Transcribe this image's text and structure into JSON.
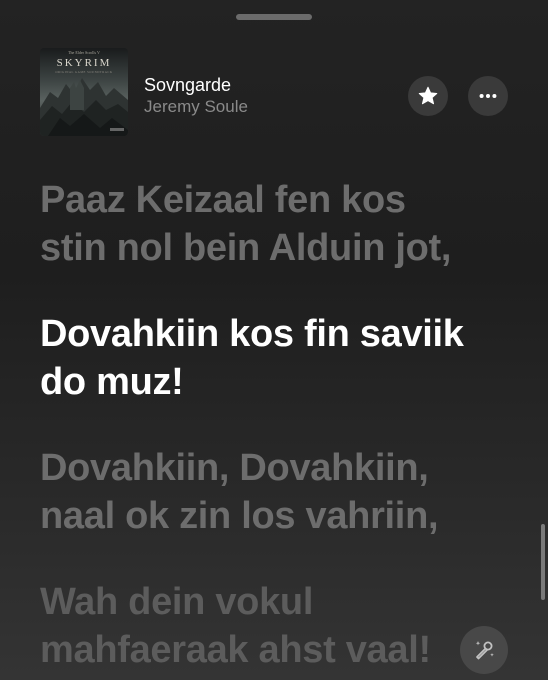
{
  "artwork": {
    "top_line": "The Elder Scrolls V",
    "title": "SKYRIM",
    "subtitle": "ORIGINAL GAME SOUNDTRACK"
  },
  "track": {
    "title": "Sovngarde",
    "artist": "Jeremy Soule"
  },
  "buttons": {
    "favorite_icon": "star-icon",
    "more_icon": "ellipsis-icon",
    "sing_icon": "microphone-sparkle-icon"
  },
  "lyrics": [
    {
      "lines": [
        "Paaz Keizaal fen kos",
        "stin nol bein Alduin jot,"
      ],
      "state": "past"
    },
    {
      "lines": [
        "Dovahkiin kos fin saviik",
        "do muz!"
      ],
      "state": "current"
    },
    {
      "lines": [
        "Dovahkiin, Dovahkiin,",
        "naal ok zin los vahriin,"
      ],
      "state": "upcoming"
    },
    {
      "lines": [
        "Wah dein vokul",
        "mahfaeraak ahst vaal!"
      ],
      "state": "upcoming"
    }
  ]
}
